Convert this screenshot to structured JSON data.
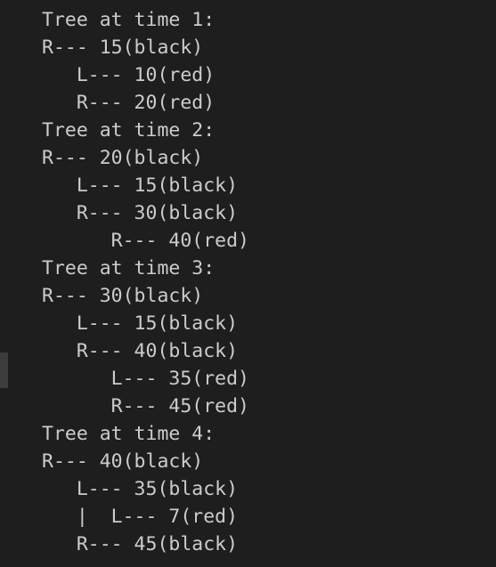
{
  "terminal": {
    "lines": [
      "Tree at time 1:",
      "R--- 15(black)",
      "   L--- 10(red)",
      "   R--- 20(red)",
      "Tree at time 2:",
      "R--- 20(black)",
      "   L--- 15(black)",
      "   R--- 30(black)",
      "      R--- 40(red)",
      "Tree at time 3:",
      "R--- 30(black)",
      "   L--- 15(black)",
      "   R--- 40(black)",
      "      L--- 35(red)",
      "      R--- 45(red)",
      "Tree at time 4:",
      "R--- 40(black)",
      "   L--- 35(black)",
      "   |  L--- 7(red)",
      "   R--- 45(black)"
    ]
  }
}
